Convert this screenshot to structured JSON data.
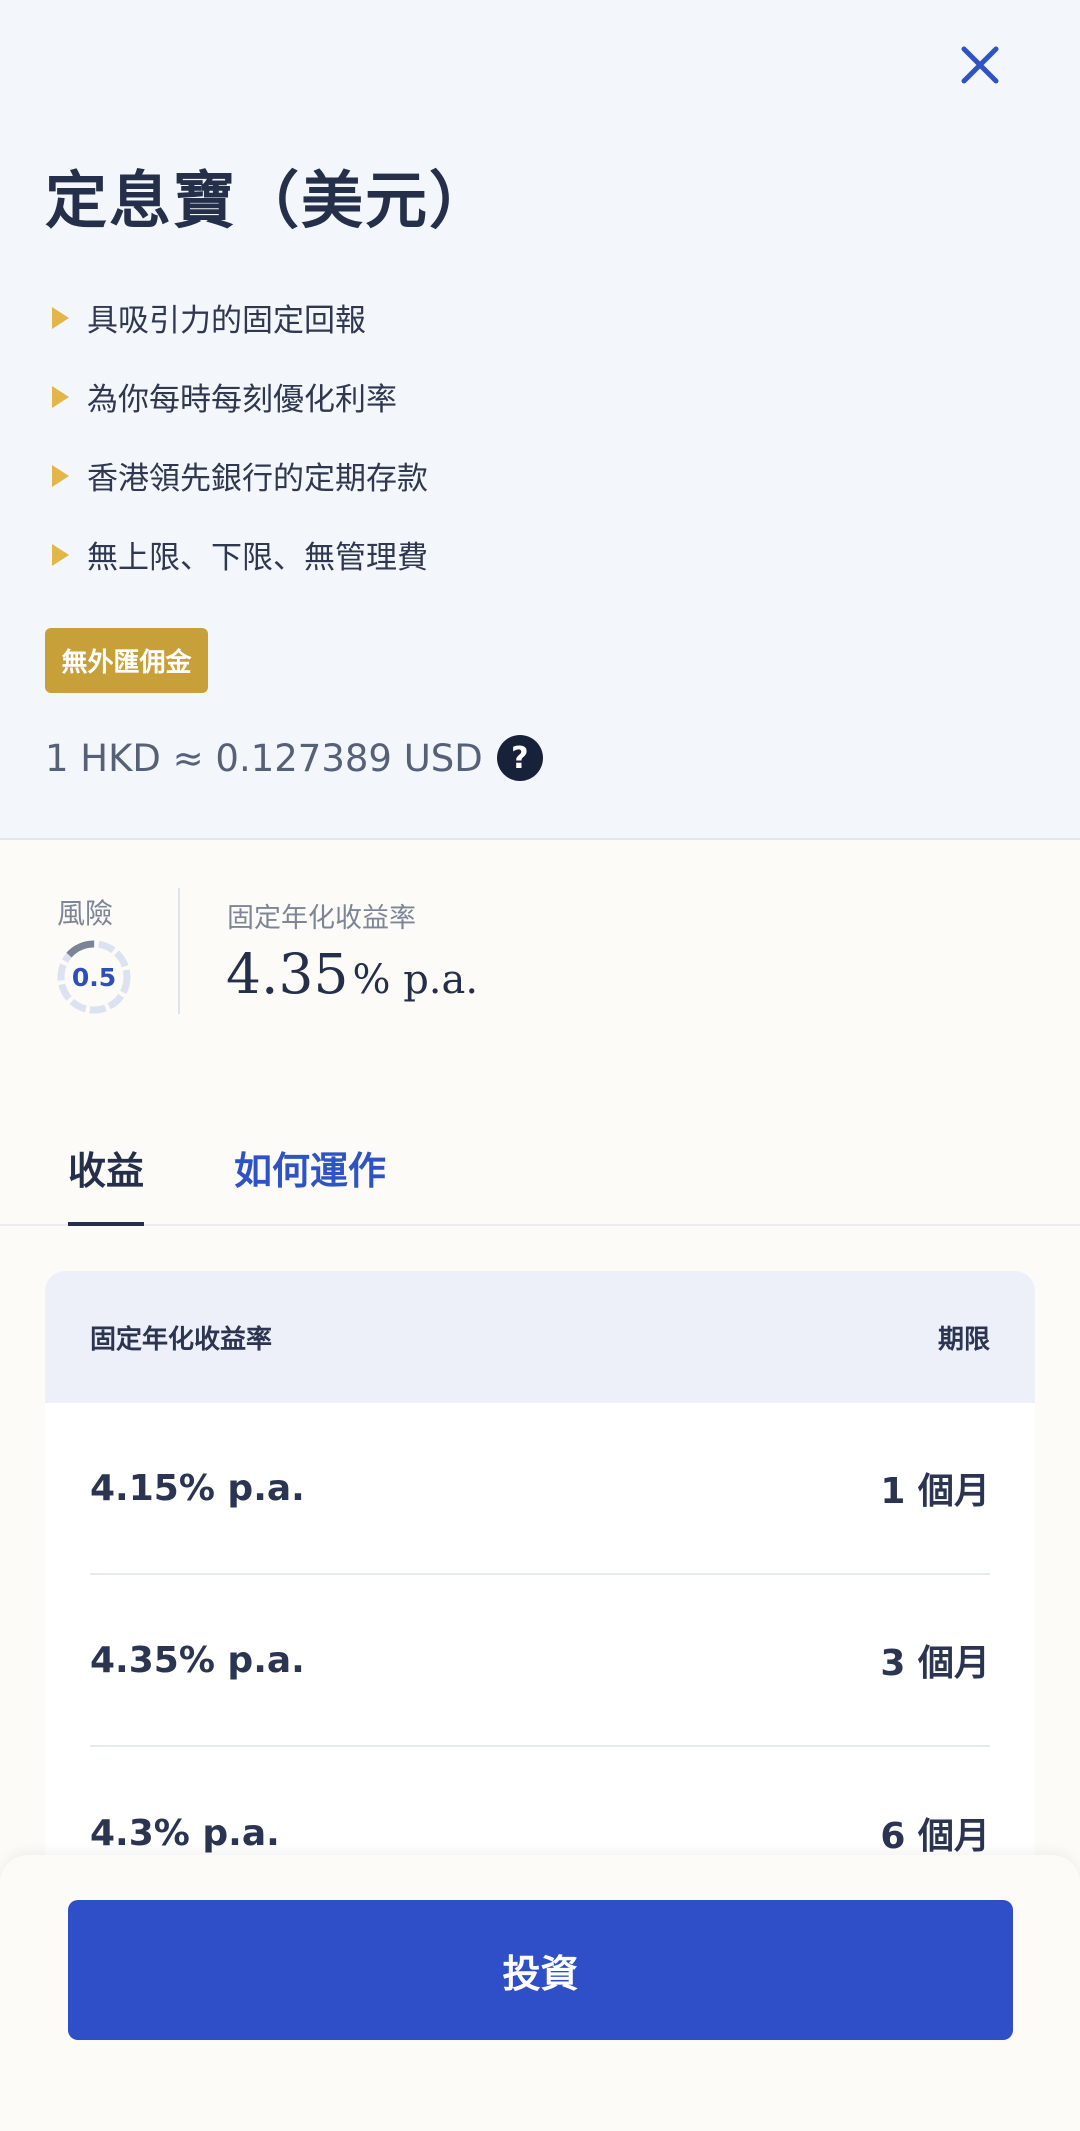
{
  "header": {
    "title": "定息寶（美元）",
    "close_icon": "close-icon"
  },
  "features": [
    "具吸引力的固定回報",
    "為你每時每刻優化利率",
    "香港領先銀行的定期存款",
    "無上限、下限、無管理費"
  ],
  "badge": "無外匯佣金",
  "exchange": {
    "text": "1 HKD ≈ 0.127389 USD",
    "help": "?"
  },
  "summary": {
    "risk_label": "風險",
    "risk_value": "0.5",
    "apr_label": "固定年化收益率",
    "apr_value": "4.35",
    "apr_unit": "% p.a."
  },
  "tabs": [
    {
      "label": "收益",
      "active": true
    },
    {
      "label": "如何運作",
      "active": false
    }
  ],
  "table": {
    "header_rate": "固定年化收益率",
    "header_term": "期限",
    "rows": [
      {
        "rate": "4.15% p.a.",
        "term": "1 個月"
      },
      {
        "rate": "4.35% p.a.",
        "term": "3 個月"
      },
      {
        "rate": "4.3% p.a.",
        "term": "6 個月"
      }
    ]
  },
  "footer": {
    "invest_label": "投資"
  },
  "colors": {
    "accent": "#2e4fc8",
    "badge": "#c8a03a",
    "bullet": "#e3b64a",
    "title": "#252f4a"
  }
}
